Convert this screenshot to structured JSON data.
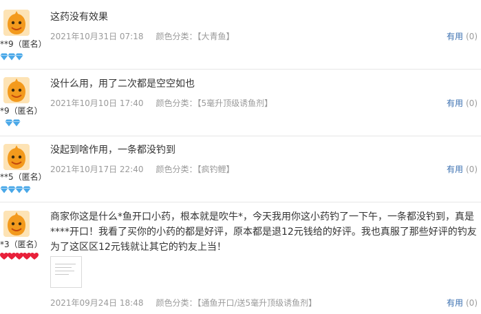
{
  "ui": {
    "sku_label": "颜色分类：",
    "useful_label": "有用"
  },
  "reviews": [
    {
      "nick": "**9（匿名）",
      "level": "diamond",
      "level_count": 3,
      "content": "这药没有效果",
      "date": "2021年10月31日 07:18",
      "sku": "【大青鱼】",
      "useful_count": "(0)"
    },
    {
      "nick": "*9（匿名）",
      "level": "diamond",
      "level_count": 2,
      "content": "没什么用，用了二次都是空空如也",
      "date": "2021年10月10日 17:40",
      "sku": "【5毫升顶级诱鱼剂】",
      "useful_count": "(0)"
    },
    {
      "nick": "**5（匿名）",
      "level": "diamond",
      "level_count": 4,
      "content": "没起到啥作用，一条都没钓到",
      "date": "2021年10月17日 22:40",
      "sku": "【疯钓鲤】",
      "useful_count": "(0)"
    },
    {
      "nick": "*3（匿名）",
      "level": "heart",
      "level_count": 5,
      "content_lines": [
        "商家你这是什么*鱼开口小药，根本就是吹牛*，今天我用你这小药钓了一下午，一条都没钓到，真是",
        "****开口！我看了买你的小药的都是好评，原本都是退12元钱给的好评。我也真服了那些好评的钓友",
        "为了这区区12元钱就让其它的钓友上当！"
      ],
      "has_photo": true,
      "date": "2021年09月24日 18:48",
      "sku": "【通鱼开口/送5毫升顶级诱鱼剂】",
      "useful_count": "(0)"
    }
  ],
  "colors": {
    "diamond": "#4aa8e8",
    "heart": "#e8203a",
    "link": "#3a6fb0",
    "meta": "#9a9a9a"
  }
}
